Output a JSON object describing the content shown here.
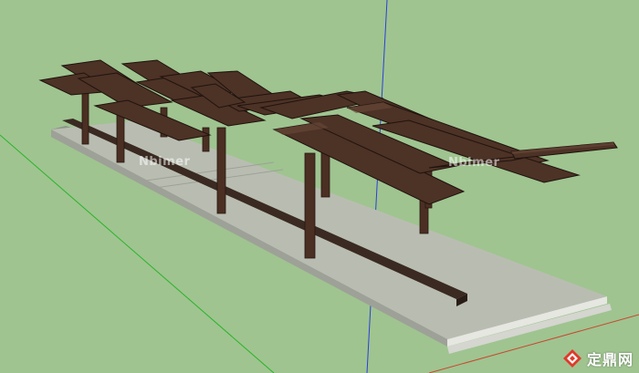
{
  "watermarks": {
    "left": "Nbimer",
    "right": "Nbimer"
  },
  "logo": {
    "text": "定鼎网",
    "icon": "dingding-logo-icon"
  },
  "colors": {
    "background": "#9fc490",
    "paving": "#b9bdb1",
    "wood": "#4a2f22",
    "axis_blue": "#2a40d8",
    "axis_green": "#28b428",
    "axis_red": "#c84830"
  }
}
